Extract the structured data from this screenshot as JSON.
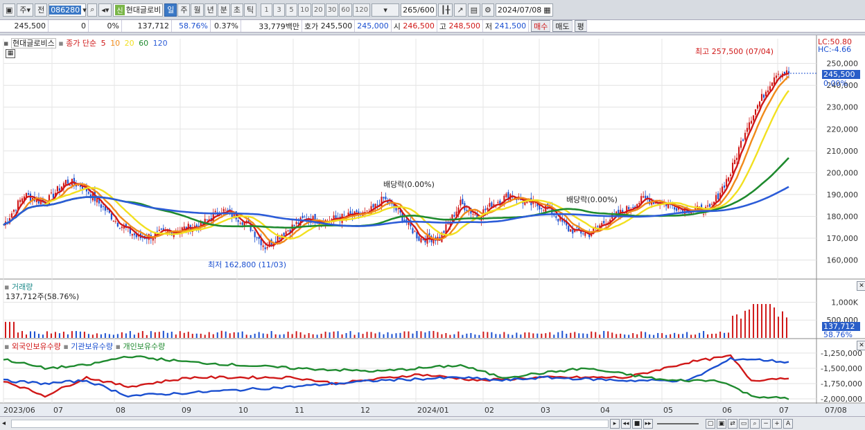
{
  "toolbar": {
    "period_code": "주",
    "mode": "전",
    "stock_code": "086280",
    "new_badge": "신",
    "stock_name": "현대글로비",
    "periods": [
      "일",
      "주",
      "월",
      "년",
      "분",
      "초",
      "틱"
    ],
    "intervals": [
      "1",
      "3",
      "5",
      "10",
      "20",
      "30",
      "60",
      "120"
    ],
    "count": "265",
    "count_total": "/600",
    "date": "2024/07/08"
  },
  "quote": {
    "price": "245,500",
    "change": "0",
    "change_pct": "0%",
    "volume": "137,712",
    "volume_ratio": "58.76%",
    "turnover": "0.37%",
    "amount": "33,779백만",
    "bid_label": "호가",
    "bid": "245,500",
    "ask": "245,000",
    "open_label": "시",
    "open": "246,500",
    "high_label": "고",
    "high": "248,500",
    "low_label": "저",
    "low": "241,500",
    "buy": "매수",
    "sell": "매도",
    "avg": "평"
  },
  "price_panel": {
    "name": "현대글로비스",
    "ma_label": "종가 단순",
    "ma_periods": [
      "5",
      "10",
      "20",
      "60",
      "120"
    ],
    "lc": "LC:50.80",
    "hc": "HC:-4.66",
    "y_ticks": [
      "250,000",
      "240,000",
      "230,000",
      "220,000",
      "210,000",
      "200,000",
      "190,000",
      "180,000",
      "170,000",
      "160,000"
    ],
    "current_tag": "245,500",
    "current_pct": "0.00%",
    "high_note": "최고 257,500 (07/04)",
    "low_note": "최저 162,800 (11/03)",
    "dividend1": "배당락(0.00%)",
    "dividend2": "배당락(0.00%)"
  },
  "volume_panel": {
    "title": "거래량",
    "readout": "137,712주(58.76%)",
    "y_ticks": [
      "1,000K",
      "500,000"
    ],
    "current_tag": "137,712",
    "current_pct": "58.76%"
  },
  "holding_panel": {
    "series": [
      "외국인보유수량",
      "기관보유수량",
      "개인보유수량"
    ],
    "y_ticks": [
      "-1,250,000",
      "-1,500,000",
      "-1,750,000",
      "-2,000,000"
    ]
  },
  "x_axis": [
    "2023/06",
    "07",
    "08",
    "09",
    "10",
    "11",
    "12",
    "2024/01",
    "02",
    "03",
    "04",
    "05",
    "06",
    "07",
    "07/08"
  ],
  "colors": {
    "up": "#d01818",
    "down": "#1a4fd0",
    "ma5": "#d01818",
    "ma10": "#f08a1a",
    "ma20": "#f2e020",
    "ma60": "#1e8a2e",
    "ma120": "#2c5cd8"
  }
}
